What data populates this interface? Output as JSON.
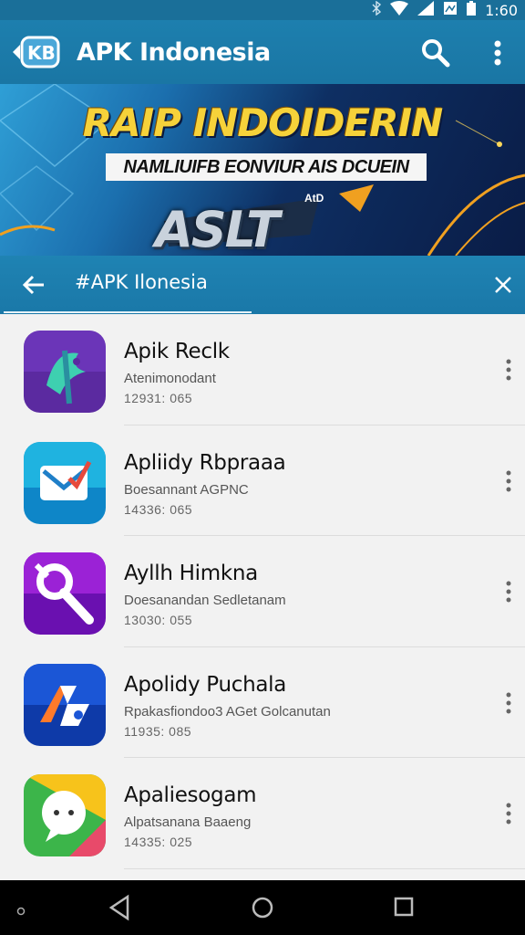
{
  "status_bar": {
    "time": "1:60",
    "icons": [
      "bluetooth-icon",
      "wifi-icon",
      "signal-icon",
      "notification-icon",
      "battery-icon"
    ]
  },
  "app_bar": {
    "title": "APK Indonesia",
    "logo": "apk-logo-icon",
    "search_icon": "search-icon",
    "more_icon": "more-vert-icon"
  },
  "banner": {
    "headline": "RAIP INDOIDERIN",
    "subheadline": "NAMLIUIFB EONVIUR AIS DCUEIN",
    "badge": "AtD",
    "logo_text": "ASLT"
  },
  "search": {
    "query": "#APK Ilonesia",
    "back_icon": "arrow-back-icon",
    "close_icon": "close-icon"
  },
  "apps": [
    {
      "name": "Apik Reclk",
      "subtitle": "Atenimonodant",
      "meta": "12931: 065",
      "icon": "app-icon-purple-bird",
      "colors": [
        "#5b2aa0",
        "#7b3fd0"
      ]
    },
    {
      "name": "Apliidy Rbpraaa",
      "subtitle": "Boesannant AGPNC",
      "meta": "14336: 065",
      "icon": "app-icon-mail",
      "colors": [
        "#1fb3e0",
        "#0e86c8"
      ]
    },
    {
      "name": "Ayllh Himkna",
      "subtitle": "Doesanandan Sedletanam",
      "meta": "13030: 055",
      "icon": "app-icon-magnifier",
      "colors": [
        "#9b22d6",
        "#6a10b0"
      ]
    },
    {
      "name": "Apolidy Puchala",
      "subtitle": "Rpakasfiondoo3 AGet Golcanutan",
      "meta": "11935: 085",
      "icon": "app-icon-music",
      "colors": [
        "#1b56d6",
        "#0e3aa8"
      ]
    },
    {
      "name": "Apaliesogam",
      "subtitle": "Alpatsanana Baaeng",
      "meta": "14335: 025",
      "icon": "app-icon-chat",
      "colors": [
        "#f7c31b",
        "#3cb54a"
      ]
    }
  ],
  "nav_bar": {
    "back": "nav-back-icon",
    "home": "nav-home-icon",
    "recents": "nav-recents-icon"
  }
}
